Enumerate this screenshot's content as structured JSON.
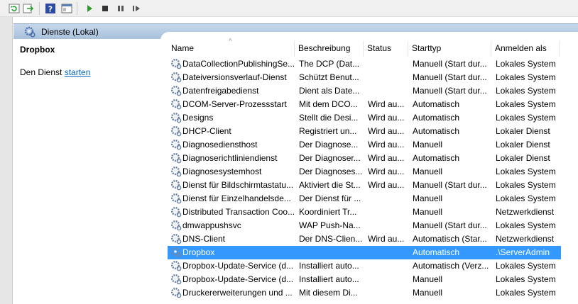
{
  "header": {
    "title": "Dienste (Lokal)"
  },
  "left_pane": {
    "service_title": "Dropbox",
    "action_prefix": "Den Dienst ",
    "action_link": "starten"
  },
  "columns": {
    "name": "Name",
    "description": "Beschreibung",
    "status": "Status",
    "startup": "Starttyp",
    "logon": "Anmelden als"
  },
  "rows": [
    {
      "name": "DataCollectionPublishingSe...",
      "desc": "The DCP (Dat...",
      "status": "",
      "start": "Manuell (Start dur...",
      "logon": "Lokales System"
    },
    {
      "name": "Dateiversionsverlauf-Dienst",
      "desc": "Schützt Benut...",
      "status": "",
      "start": "Manuell (Start dur...",
      "logon": "Lokales System"
    },
    {
      "name": "Datenfreigabedienst",
      "desc": "Dient als Date...",
      "status": "",
      "start": "Manuell (Start dur...",
      "logon": "Lokales System"
    },
    {
      "name": "DCOM-Server-Prozessstart",
      "desc": "Mit dem DCO...",
      "status": "Wird au...",
      "start": "Automatisch",
      "logon": "Lokales System"
    },
    {
      "name": "Designs",
      "desc": "Stellt die Desi...",
      "status": "Wird au...",
      "start": "Automatisch",
      "logon": "Lokales System"
    },
    {
      "name": "DHCP-Client",
      "desc": "Registriert un...",
      "status": "Wird au...",
      "start": "Automatisch",
      "logon": "Lokaler Dienst"
    },
    {
      "name": "Diagnosediensthost",
      "desc": "Der Diagnose...",
      "status": "Wird au...",
      "start": "Manuell",
      "logon": "Lokaler Dienst"
    },
    {
      "name": "Diagnoserichtliniendienst",
      "desc": "Der Diagnoser...",
      "status": "Wird au...",
      "start": "Automatisch",
      "logon": "Lokaler Dienst"
    },
    {
      "name": "Diagnosesystemhost",
      "desc": "Der Diagnoses...",
      "status": "Wird au...",
      "start": "Manuell",
      "logon": "Lokales System"
    },
    {
      "name": "Dienst für Bildschirmtastatu...",
      "desc": "Aktiviert die St...",
      "status": "Wird au...",
      "start": "Manuell (Start dur...",
      "logon": "Lokales System"
    },
    {
      "name": "Dienst für Einzelhandelsde...",
      "desc": "Der Dienst für ...",
      "status": "",
      "start": "Manuell",
      "logon": "Lokales System"
    },
    {
      "name": "Distributed Transaction Coo...",
      "desc": "Koordiniert Tr...",
      "status": "",
      "start": "Manuell",
      "logon": "Netzwerkdienst"
    },
    {
      "name": "dmwappushsvc",
      "desc": "WAP Push-Na...",
      "status": "",
      "start": "Manuell (Start dur...",
      "logon": "Lokales System"
    },
    {
      "name": "DNS-Client",
      "desc": "Der DNS-Clien...",
      "status": "Wird au...",
      "start": "Automatisch (Star...",
      "logon": "Netzwerkdienst"
    },
    {
      "name": "Dropbox",
      "desc": "",
      "status": "",
      "start": "Automatisch",
      "logon": ".\\ServerAdmin",
      "selected": true
    },
    {
      "name": "Dropbox-Update-Service (d...",
      "desc": "Installiert auto...",
      "status": "",
      "start": "Automatisch (Verz...",
      "logon": "Lokales System"
    },
    {
      "name": "Dropbox-Update-Service (d...",
      "desc": "Installiert auto...",
      "status": "",
      "start": "Manuell",
      "logon": "Lokales System"
    },
    {
      "name": "Druckererweiterungen und ...",
      "desc": "Mit diesem Di...",
      "status": "",
      "start": "Manuell",
      "logon": "Lokales System"
    }
  ]
}
